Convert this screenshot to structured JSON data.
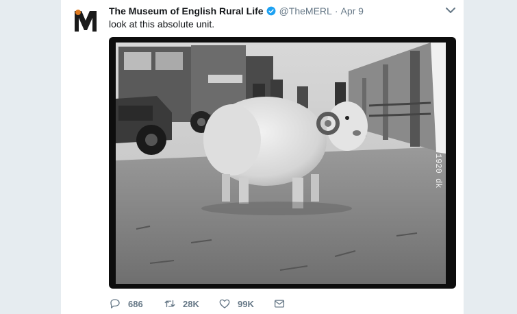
{
  "tweet": {
    "author_name": "The Museum of English Rural Life",
    "handle": "@TheMERL",
    "separator": "·",
    "time": "Apr 9",
    "text": "look at this absolute unit.",
    "avatar_letter": "M",
    "image_caption_edge": "1920 dk",
    "actions": {
      "reply_count": "686",
      "retweet_count": "28K",
      "like_count": "99K"
    }
  },
  "colors": {
    "verified": "#1da1f2",
    "text_secondary": "#657786",
    "page_bg": "#e6ecf0"
  }
}
